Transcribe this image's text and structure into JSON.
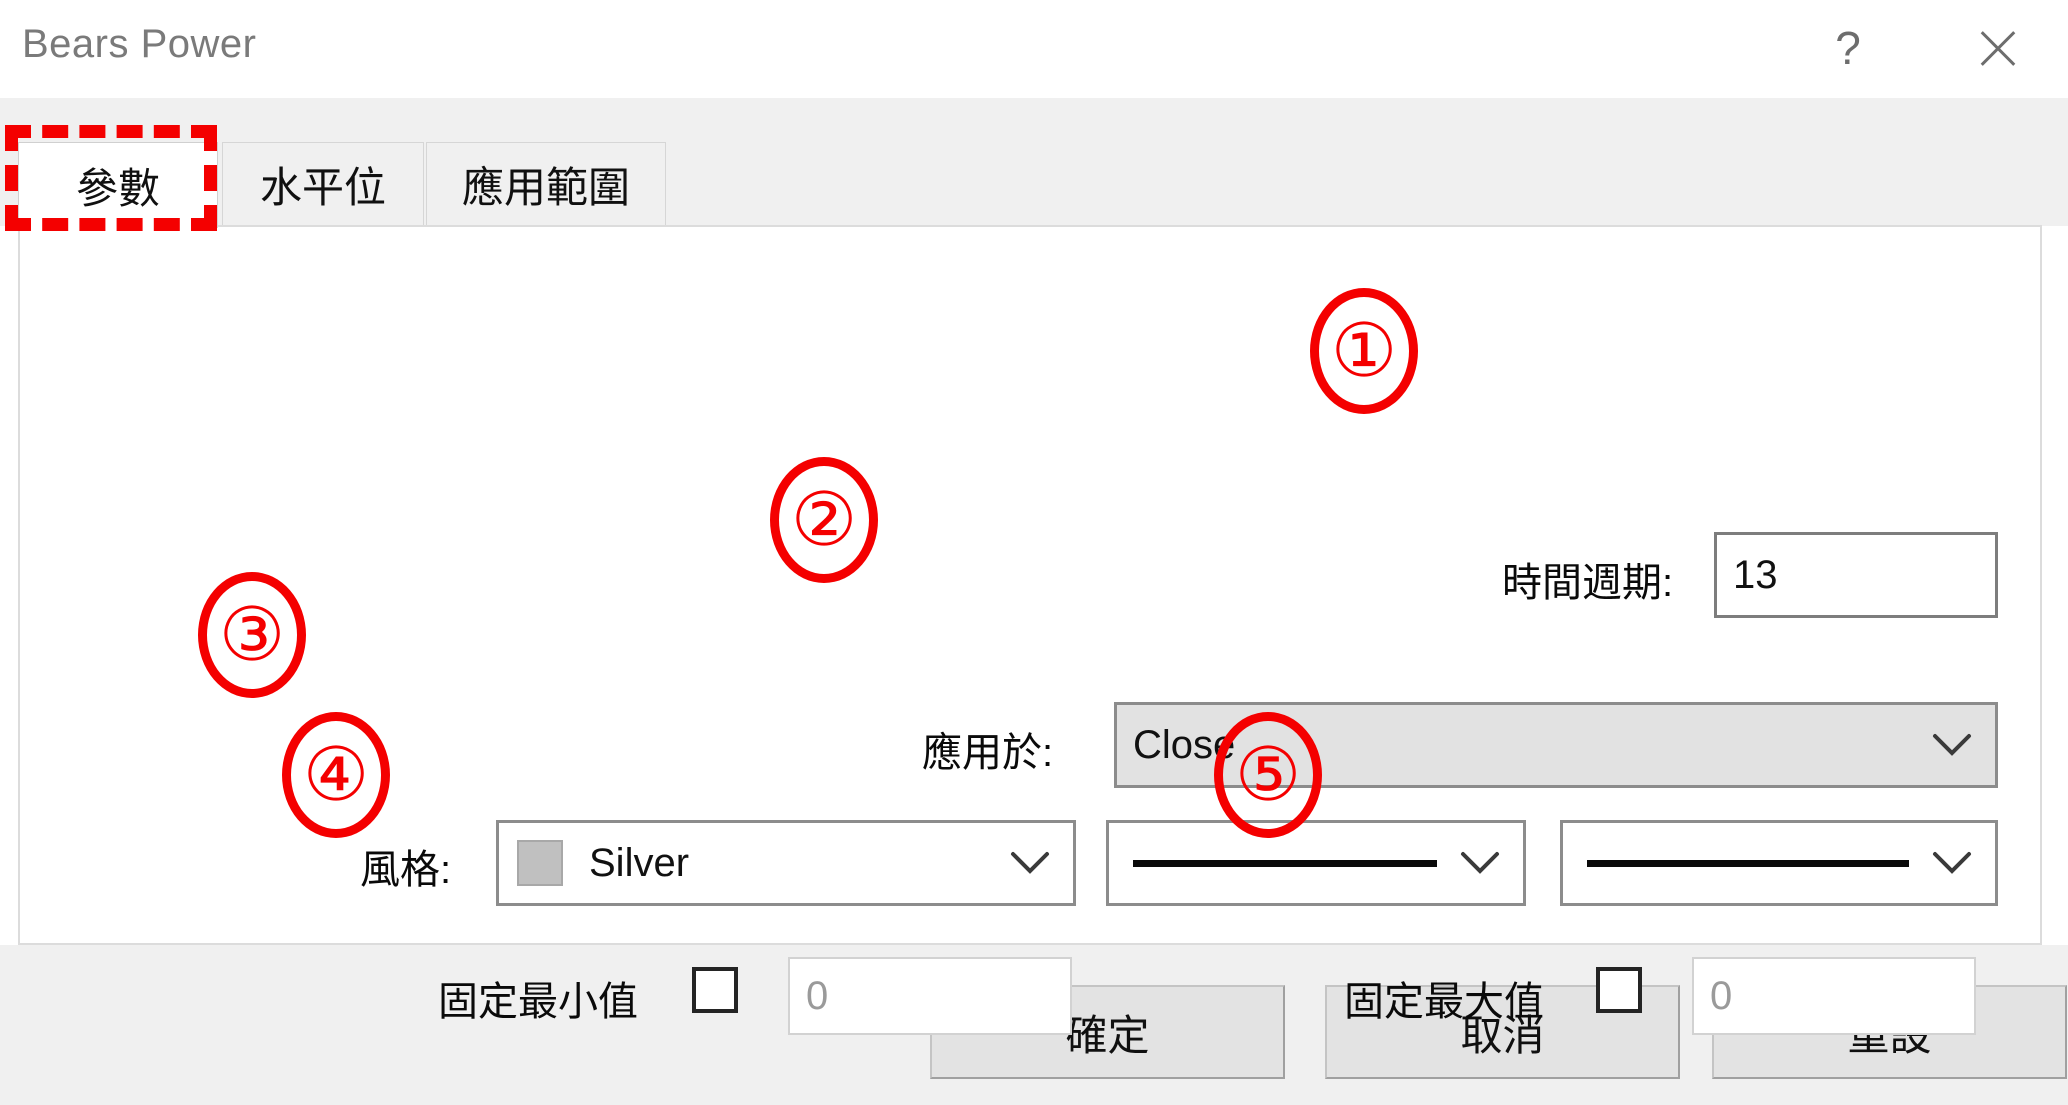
{
  "window": {
    "title": "Bears Power",
    "help_label": "?",
    "close_label": "close-icon"
  },
  "tabs": [
    {
      "label": "參數",
      "active": true
    },
    {
      "label": "水平位",
      "active": false
    },
    {
      "label": "應用範圍",
      "active": false
    }
  ],
  "form": {
    "period": {
      "label": "時間週期:",
      "value": "13",
      "annotation": "①"
    },
    "apply_to": {
      "label": "應用於:",
      "value": "Close",
      "annotation": "②"
    },
    "style": {
      "label": "風格:",
      "color_name": "Silver",
      "color_hex": "#c0c0c0",
      "line_width_value": "solid-line",
      "line_style_value": "solid-line",
      "annotation": "③"
    },
    "fix_minimum": {
      "label": "固定最小值",
      "checked": false,
      "value": "0",
      "annotation": "④"
    },
    "fix_maximum": {
      "label": "固定最大值",
      "checked": false,
      "value": "0",
      "annotation": "⑤"
    }
  },
  "footer": {
    "ok_label": "確定",
    "cancel_label": "取消",
    "reset_label": "重設"
  },
  "colors": {
    "annotation_red": "#f40000",
    "dialog_background": "#ffffff",
    "chrome_gray": "#f0f0f0"
  }
}
